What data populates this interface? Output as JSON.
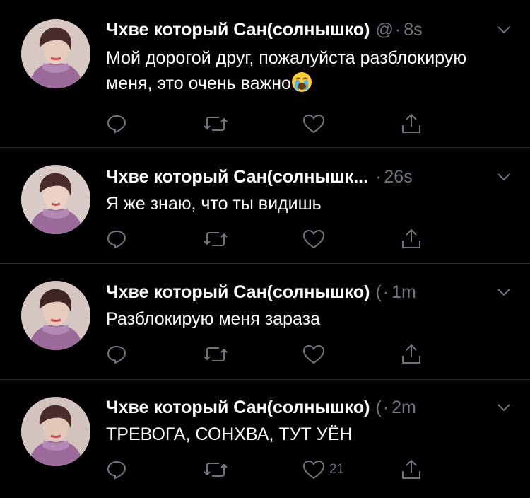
{
  "colors": {
    "background": "#000000",
    "text": "#ffffff",
    "secondary": "#6e767d",
    "separator": "#2a2d31"
  },
  "tweets": [
    {
      "name": "Чхве который Сан(солнышко)",
      "handle": "@",
      "dot": "·",
      "time": "8s",
      "text": "Мой дорогой друг, пожалуйста разблокирую меня, это очень важно",
      "emoji": "loudly-crying-face",
      "like_count": ""
    },
    {
      "name": "Чхве который Сан(солнышк...",
      "handle": "",
      "dot": "·",
      "time": "26s",
      "text": "Я же знаю, что  ты видишь",
      "like_count": ""
    },
    {
      "name": "Чхве который Сан(солнышко)",
      "handle": "(",
      "dot": "·",
      "time": "1m",
      "text": "Разблокирую меня зараза",
      "like_count": ""
    },
    {
      "name": "Чхве который Сан(солнышко)",
      "handle": "(",
      "dot": "·",
      "time": "2m",
      "text": "ТРЕВОГА, СОНХВА, ТУТ УЁН",
      "like_count": "21"
    }
  ],
  "icons": {
    "reply": "reply-icon",
    "retweet": "retweet-icon",
    "like": "like-icon",
    "share": "share-icon",
    "caret": "chevron-down-icon"
  }
}
